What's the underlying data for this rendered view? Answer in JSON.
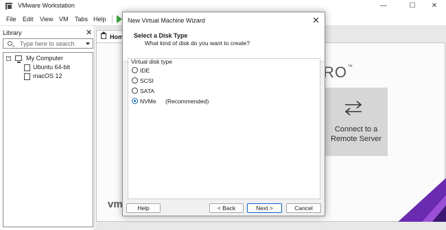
{
  "window": {
    "title": "VMware Workstation",
    "controls": {
      "minimize": "—",
      "maximize": "☐",
      "close": "✕"
    }
  },
  "menubar": {
    "items": [
      "File",
      "Edit",
      "View",
      "VM",
      "Tabs",
      "Help"
    ]
  },
  "library": {
    "header": "Library",
    "close": "✕",
    "search_placeholder": "Type here to search",
    "tree": {
      "root": "My Computer",
      "root_expander": "−",
      "vms": [
        "Ubuntu 64-bit",
        "macOS 12"
      ]
    }
  },
  "tabs": {
    "home": "Hom"
  },
  "home_page": {
    "pro_mark": "RO",
    "pro_tm": "™",
    "remote_card": {
      "line1": "Connect to a",
      "line2": "Remote Server"
    },
    "logo_text": "vm"
  },
  "dialog": {
    "title": "New Virtual Machine Wizard",
    "close": "✕",
    "header_title": "Select a Disk Type",
    "header_subtitle": "What kind of disk do you want to create?",
    "group_label": "Virtual disk type",
    "options": [
      {
        "label": "IDE",
        "checked": false
      },
      {
        "label": "SCSI",
        "checked": false
      },
      {
        "label": "SATA",
        "checked": false
      },
      {
        "label": "NVMe",
        "checked": true,
        "note": "(Recommended)"
      }
    ],
    "buttons": {
      "help": "Help",
      "back": "< Back",
      "next": "Next >",
      "cancel": "Cancel"
    }
  },
  "colors": {
    "accent": "#0c5fb8",
    "play": "#3aa43a",
    "purple": "#7b2fbf"
  }
}
